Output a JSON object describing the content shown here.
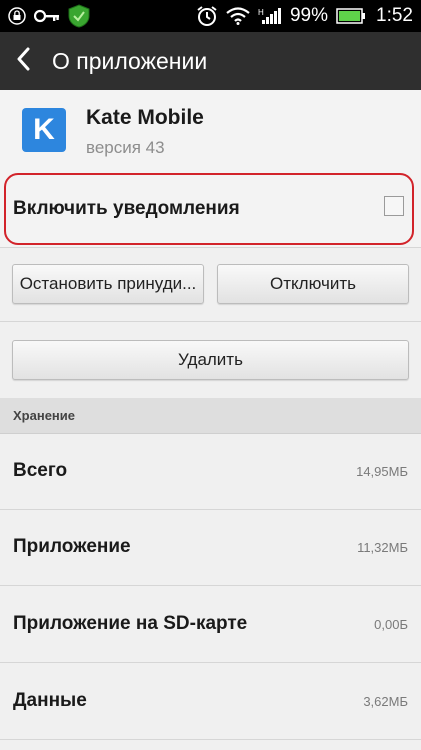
{
  "status_bar": {
    "icons_left": [
      "lock-icon",
      "key-icon",
      "shield-icon"
    ],
    "icons_right": [
      "alarm-icon",
      "wifi-icon",
      "signal-icon",
      "battery-icon"
    ],
    "battery_percent": "99%",
    "time": "1:52"
  },
  "action_bar": {
    "back_icon": "chevron-left-icon",
    "title": "О приложении"
  },
  "app": {
    "icon_letter": "K",
    "icon_color": "#2d86de",
    "name": "Kate Mobile",
    "version": "версия 43"
  },
  "notifications": {
    "label": "Включить уведомления",
    "checked": false,
    "highlight_color": "#d2232a"
  },
  "buttons": {
    "force_stop": "Остановить принуди...",
    "disable": "Отключить",
    "uninstall": "Удалить"
  },
  "storage": {
    "header": "Хранение",
    "rows": [
      {
        "label": "Всего",
        "value": "14,95МБ"
      },
      {
        "label": "Приложение",
        "value": "11,32МБ"
      },
      {
        "label": "Приложение на SD-карте",
        "value": "0,00Б"
      },
      {
        "label": "Данные",
        "value": "3,62МБ"
      }
    ]
  }
}
